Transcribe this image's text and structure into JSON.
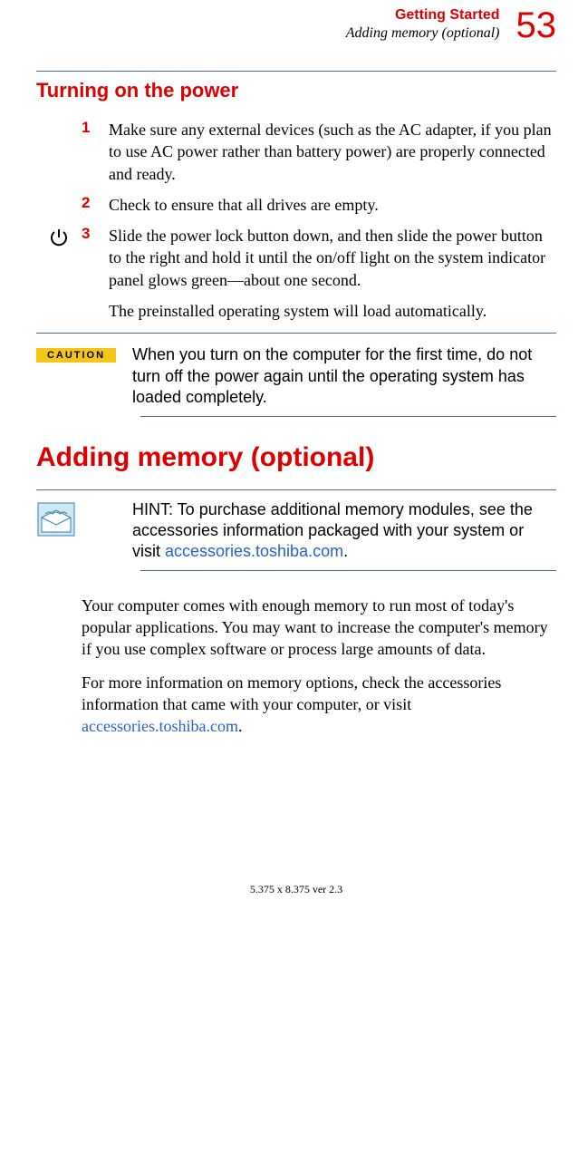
{
  "header": {
    "chapter": "Getting Started",
    "section": "Adding memory (optional)",
    "page_number": "53"
  },
  "section1": {
    "heading": "Turning on the power",
    "steps": [
      {
        "n": "1",
        "text": "Make sure any external devices (such as the AC adapter, if you plan to use AC power rather than battery power) are properly connected and ready."
      },
      {
        "n": "2",
        "text": "Check to ensure that all drives are empty."
      },
      {
        "n": "3",
        "text": "Slide the power lock button down, and then slide the power button to the right and hold it until the on/off light on the system indicator panel glows green—about one second."
      }
    ],
    "after_step": "The preinstalled operating system will load automatically."
  },
  "caution": {
    "label": "CAUTION",
    "text": "When you turn on the computer for the first time, do not turn off the power again until the operating system has loaded completely."
  },
  "section2": {
    "heading": "Adding memory (optional)"
  },
  "hint": {
    "prefix": "HINT: To purchase additional memory modules, see the accessories information packaged with your system or visit ",
    "link": "accessories.toshiba.com",
    "suffix": "."
  },
  "body": {
    "p1": "Your computer comes with enough memory to run most of today's popular applications. You may want to increase the computer's memory if you use complex software or process large amounts of data.",
    "p2_prefix": "For more information on memory options, check the accessories information that came with your computer, or visit ",
    "p2_link": "accessories.toshiba.com",
    "p2_suffix": "."
  },
  "footer": "5.375 x 8.375 ver 2.3"
}
